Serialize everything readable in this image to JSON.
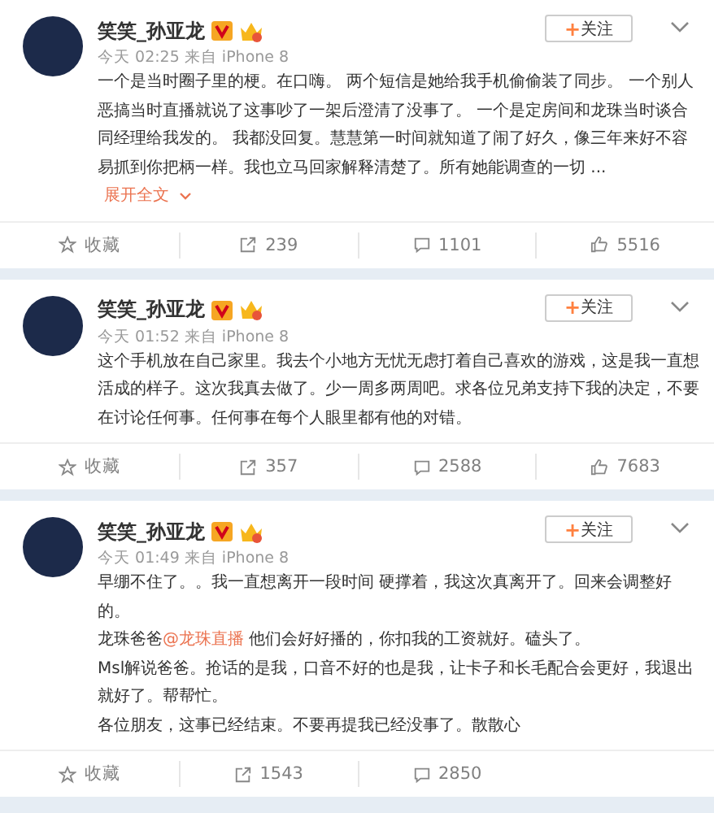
{
  "posts": [
    {
      "author": "笑笑_孙亚龙",
      "time": "今天 02:25 来自 iPhone 8",
      "follow": {
        "plus": "+",
        "label": "关注"
      },
      "paragraphs": [
        [
          {
            "kind": "text",
            "text": "一个是当时圈子里的梗。在口嗨。 两个短信是她给我手机偷偷装了同步。 一个别人恶搞当时直播就说了这事吵了一架后澄清了没事了。 一个是定房间和龙珠当时谈合同经理给我发的。 我都没回复。慧慧第一时间就知道了闹了好久，像三年来好不容易抓到你把柄一样。我也立马回家解释清楚了。所有她能调查的一切 ..."
          }
        ]
      ],
      "expand": "展开全文",
      "actions": [
        {
          "kind": "favorite",
          "label": "收藏"
        },
        {
          "kind": "repost",
          "label": "239"
        },
        {
          "kind": "comment",
          "label": "1101"
        },
        {
          "kind": "like",
          "label": "5516"
        }
      ]
    },
    {
      "author": "笑笑_孙亚龙",
      "time": "今天 01:52 来自 iPhone 8",
      "follow": {
        "plus": "+",
        "label": "关注"
      },
      "paragraphs": [
        [
          {
            "kind": "text",
            "text": "这个手机放在自己家里。我去个小地方无忧无虑打着自己喜欢的游戏，这是我一直想活成的样子。这次我真去做了。少一周多两周吧。求各位兄弟支持下我的决定，不要在讨论任何事。任何事在每个人眼里都有他的对错。"
          }
        ]
      ],
      "actions": [
        {
          "kind": "favorite",
          "label": "收藏"
        },
        {
          "kind": "repost",
          "label": "357"
        },
        {
          "kind": "comment",
          "label": "2588"
        },
        {
          "kind": "like",
          "label": "7683"
        }
      ]
    },
    {
      "author": "笑笑_孙亚龙",
      "time": "今天 01:49 来自 iPhone 8",
      "follow": {
        "plus": "+",
        "label": "关注"
      },
      "paragraphs": [
        [
          {
            "kind": "text",
            "text": "早绷不住了。。我一直想离开一段时间 硬撑着，我这次真离开了。回来会调整好的。"
          }
        ],
        [
          {
            "kind": "text",
            "text": "龙珠爸爸"
          },
          {
            "kind": "mention",
            "text": "@龙珠直播"
          },
          {
            "kind": "text",
            "text": " 他们会好好播的，你扣我的工资就好。磕头了。"
          }
        ],
        [
          {
            "kind": "text",
            "text": "Msl解说爸爸。抢话的是我，口音不好的也是我，让卡子和长毛配合会更好，我退出就好了。帮帮忙。"
          }
        ],
        [
          {
            "kind": "text",
            "text": "各位朋友，这事已经结束。不要再提我已经没事了。散散心"
          }
        ]
      ],
      "actions": [
        {
          "kind": "favorite",
          "label": "收藏"
        },
        {
          "kind": "repost",
          "label": "1543"
        },
        {
          "kind": "comment",
          "label": "2850"
        }
      ]
    }
  ]
}
